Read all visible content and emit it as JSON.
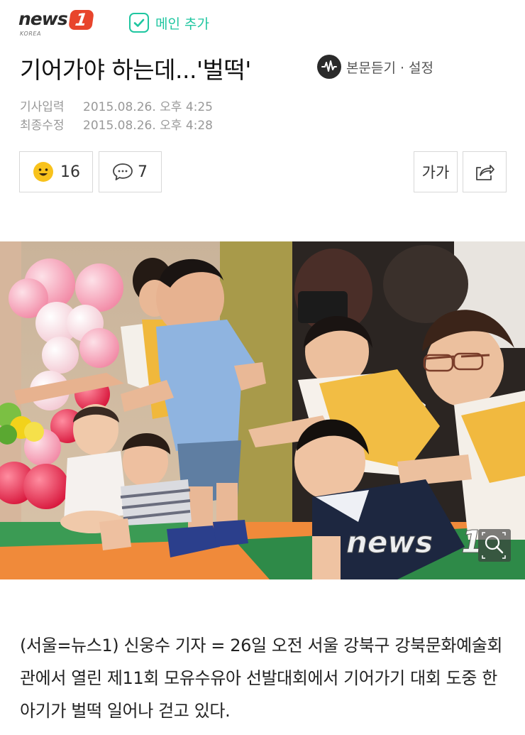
{
  "header": {
    "logo_word": "news",
    "logo_number": "1",
    "logo_sub": "KOREA",
    "main_add_label": "메인 추가"
  },
  "article": {
    "title": "기어가야 하는데...'벌떡'",
    "listen_label": "본문듣기",
    "settings_label": "· 설정",
    "published_label": "기사입력",
    "published_value": "2015.08.26. 오후 4:25",
    "modified_label": "최종수정",
    "modified_value": "2015.08.26. 오후 4:28",
    "body": "(서울=뉴스1) 신웅수 기자 = 26일 오전 서울 강북구 강북문화예술회관에서 열린 제11회 모유수유아 선발대회에서 기어가기 대회 도중 한 아기가 벌떡 일어나 걷고 있다."
  },
  "reactions": {
    "like_count": "16",
    "comment_count": "7",
    "font_size_label": "가가"
  },
  "photo": {
    "watermark_word": "news",
    "watermark_number": "1"
  },
  "colors": {
    "brand_red": "#e8452c",
    "accent_green": "#1fc6a0"
  },
  "icons": [
    "check-icon",
    "audio-icon",
    "smile-icon",
    "comment-icon",
    "share-icon",
    "zoom-icon"
  ]
}
